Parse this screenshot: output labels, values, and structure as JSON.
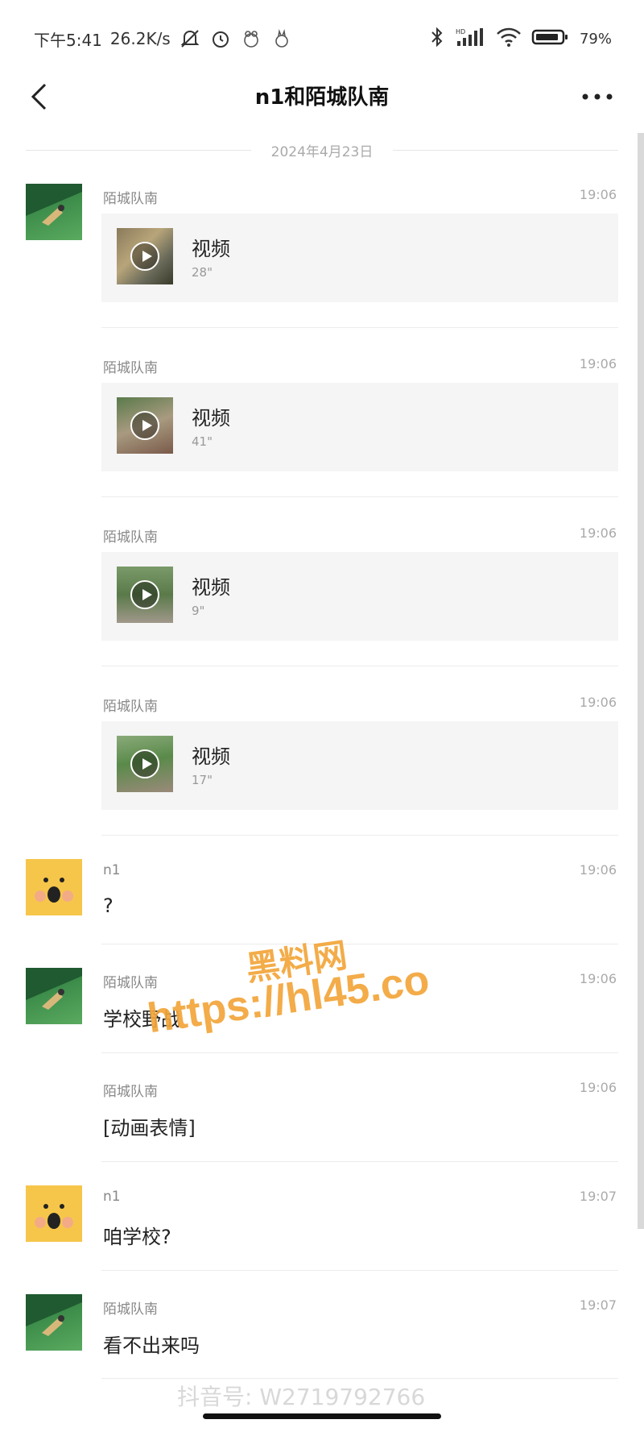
{
  "status_bar": {
    "time": "下午5:41",
    "network_speed": "26.2K/s",
    "battery": "79%",
    "signal_label": "HD"
  },
  "nav": {
    "title": "n1和陌城队南",
    "back_icon": "chevron-left-icon",
    "more_icon": "more-horizontal-icon"
  },
  "date_divider": "2024年4月23日",
  "messages": [
    {
      "type": "video",
      "sender": "陌城队南",
      "time": "19:06",
      "title": "视频",
      "duration": "28\"",
      "avatar": "green"
    },
    {
      "type": "video",
      "sender": "陌城队南",
      "time": "19:06",
      "title": "视频",
      "duration": "41\"",
      "avatar": "none"
    },
    {
      "type": "video",
      "sender": "陌城队南",
      "time": "19:06",
      "title": "视频",
      "duration": "9\"",
      "avatar": "none"
    },
    {
      "type": "video",
      "sender": "陌城队南",
      "time": "19:06",
      "title": "视频",
      "duration": "17\"",
      "avatar": "none"
    },
    {
      "type": "text",
      "sender": "n1",
      "time": "19:06",
      "text": "?",
      "avatar": "yellow"
    },
    {
      "type": "text",
      "sender": "陌城队南",
      "time": "19:06",
      "text": "学校野战",
      "avatar": "green"
    },
    {
      "type": "text",
      "sender": "陌城队南",
      "time": "19:06",
      "text": "[动画表情]",
      "avatar": "none"
    },
    {
      "type": "text",
      "sender": "n1",
      "time": "19:07",
      "text": "咱学校?",
      "avatar": "yellow"
    },
    {
      "type": "text",
      "sender": "陌城队南",
      "time": "19:07",
      "text": "看不出来吗",
      "avatar": "green"
    }
  ],
  "watermark": {
    "line1": "黑料网",
    "line2": "https://hl45.co",
    "douyin": "抖音号: W2719792766"
  },
  "colors": {
    "watermark": "#f2a53a",
    "avatar_green": "#3f8f4c",
    "avatar_yellow": "#f6c64a"
  }
}
